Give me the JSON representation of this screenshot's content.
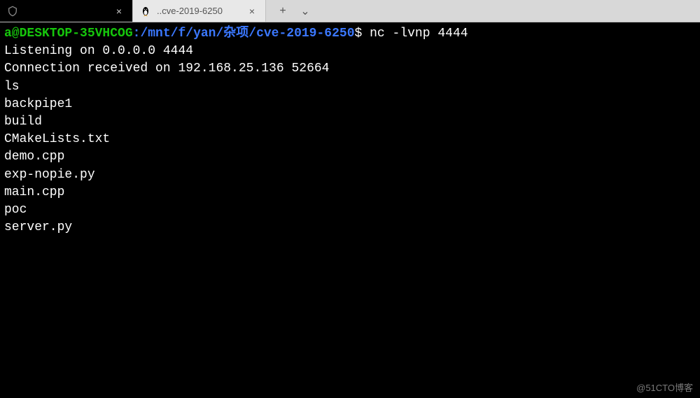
{
  "tabs": {
    "active": {
      "title": "",
      "close_glyph": "×"
    },
    "inactive": {
      "title": "..cve-2019-6250",
      "close_glyph": "×"
    },
    "new_glyph": "+",
    "dropdown_glyph": "⌄"
  },
  "prompt": {
    "user": "a@DESKTOP-35VHCOG",
    "colon": ":",
    "path": "/mnt/f/yan/杂项/cve-2019-6250",
    "dollar": "$",
    "command": "nc -lvnp 4444"
  },
  "output": [
    "Listening on 0.0.0.0 4444",
    "Connection received on 192.168.25.136 52664",
    "ls",
    "backpipe1",
    "build",
    "CMakeLists.txt",
    "demo.cpp",
    "exp-nopie.py",
    "main.cpp",
    "poc",
    "server.py"
  ],
  "watermark": "@51CTO博客"
}
